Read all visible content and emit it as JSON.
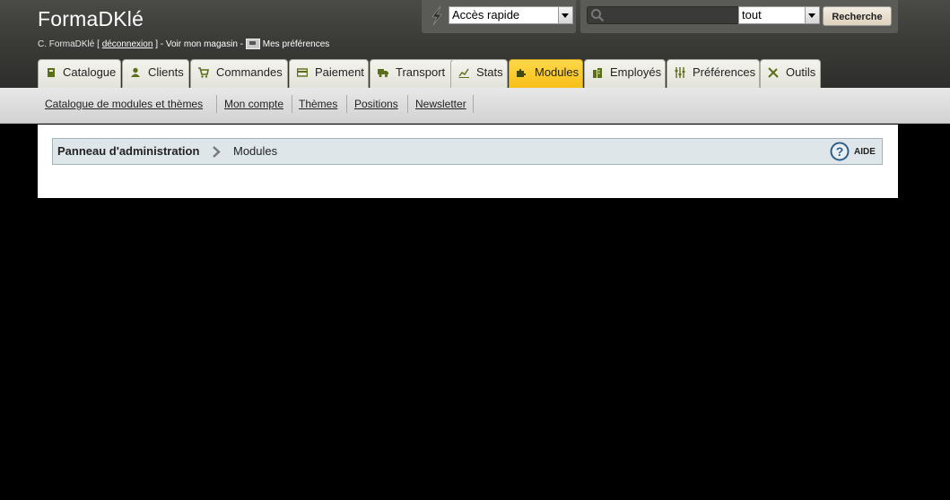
{
  "header": {
    "shop_name": "FormaDKlé",
    "user_prefix": "C. FormaDKlé [",
    "logout_label": "déconnexion",
    "view_store_text": "] - Voir mon magasin -",
    "preferences_label": "Mes préférences"
  },
  "quick_access": {
    "selected": "Accès rapide"
  },
  "search": {
    "value": "",
    "scope_selected": "tout",
    "button_label": "Recherche"
  },
  "tabs": [
    {
      "label": "Catalogue",
      "icon": "book-icon"
    },
    {
      "label": "Clients",
      "icon": "user-icon"
    },
    {
      "label": "Commandes",
      "icon": "cart-icon"
    },
    {
      "label": "Paiement",
      "icon": "card-icon"
    },
    {
      "label": "Transport",
      "icon": "truck-icon"
    },
    {
      "label": "Stats",
      "icon": "chart-icon"
    },
    {
      "label": "Modules",
      "icon": "puzzle-icon",
      "active": true
    },
    {
      "label": "Employés",
      "icon": "building-icon"
    },
    {
      "label": "Préférences",
      "icon": "sliders-icon"
    },
    {
      "label": "Outils",
      "icon": "tools-icon"
    }
  ],
  "submenu": [
    "Catalogue de modules et thèmes",
    "Mon compte",
    "Thèmes",
    "Positions",
    "Newsletter"
  ],
  "breadcrumb": {
    "root": "Panneau d'administration",
    "current": "Modules"
  },
  "help": {
    "label": "AIDE"
  },
  "colors": {
    "active_tab": "#f7bf18",
    "breadcrumb_bg": "#dfe6ea",
    "header_bg": "#3b3b38"
  }
}
